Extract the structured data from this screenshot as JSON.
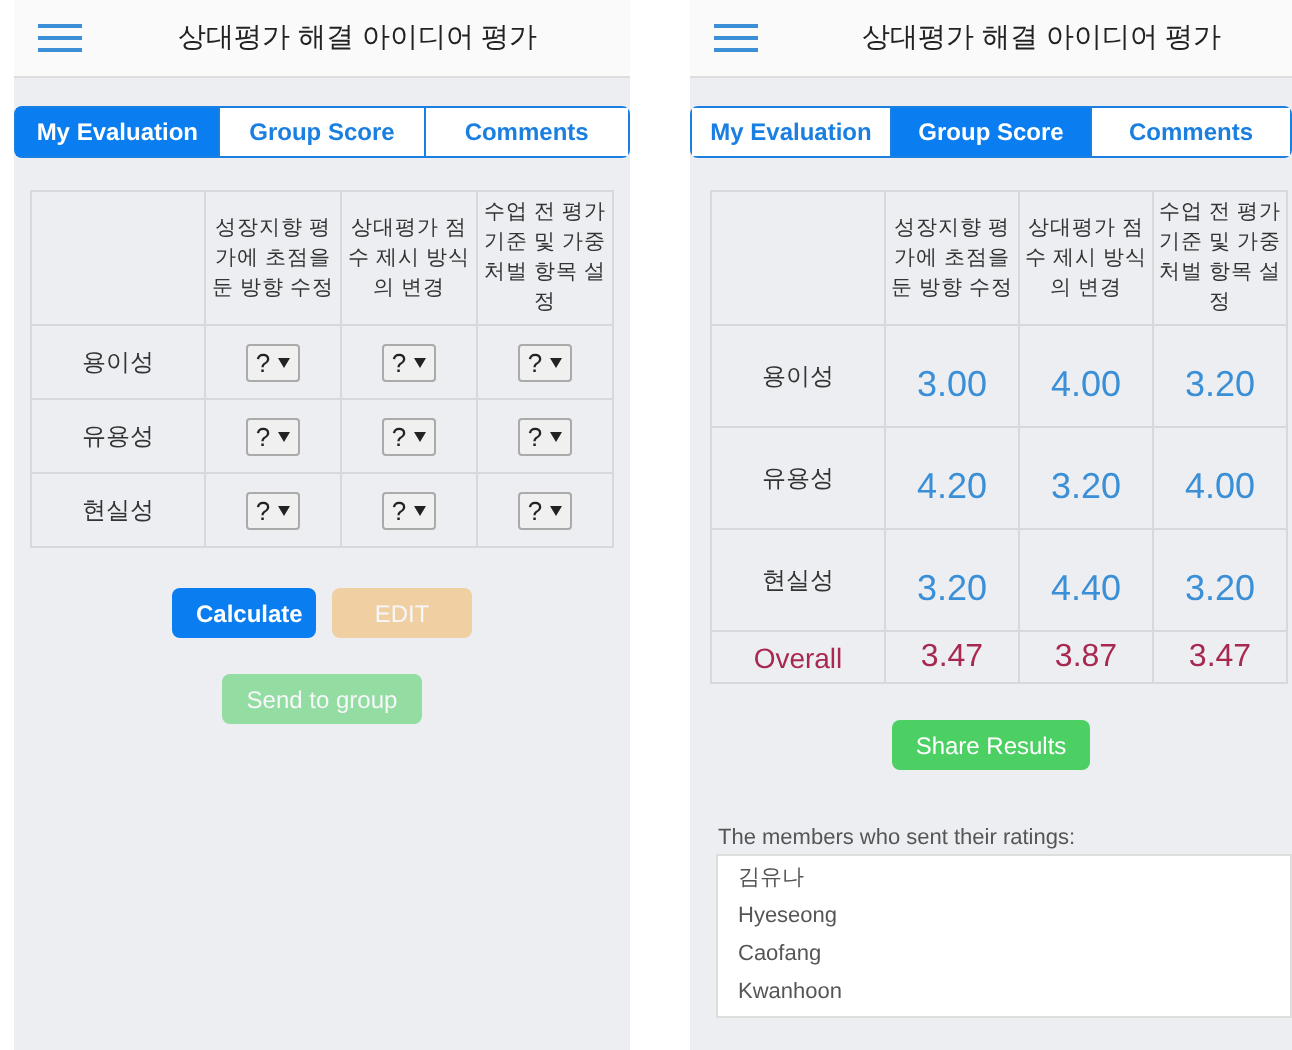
{
  "screens": [
    {
      "title": "상대평가 해결 아이디어 평가",
      "tabs": [
        {
          "label": "My Evaluation",
          "selected": true
        },
        {
          "label": "Group Score",
          "selected": false
        },
        {
          "label": "Comments",
          "selected": false
        }
      ],
      "table": {
        "columns": [
          "성장지향 평가에 초점을 둔 방향 수정",
          "상대평가 점수 제시 방식의 변경",
          "수업 전 평가 기준 및 가중 처벌 항목 설정"
        ],
        "rows": [
          {
            "kind": "select",
            "label": "용이성",
            "cells": [
              "?",
              "?",
              "?"
            ]
          },
          {
            "kind": "select",
            "label": "유용성",
            "cells": [
              "?",
              "?",
              "?"
            ]
          },
          {
            "kind": "select",
            "label": "현실성",
            "cells": [
              "?",
              "?",
              "?"
            ]
          }
        ]
      },
      "button_rows": [
        [
          {
            "label": "Calculate",
            "kind": "primary",
            "disabled": false
          },
          {
            "label": "EDIT",
            "kind": "warning",
            "disabled": true
          }
        ],
        [
          {
            "label": "Send to group",
            "kind": "success",
            "disabled": true
          }
        ]
      ]
    },
    {
      "title": "상대평가 해결 아이디어 평가",
      "tabs": [
        {
          "label": "My Evaluation",
          "selected": false
        },
        {
          "label": "Group Score",
          "selected": true
        },
        {
          "label": "Comments",
          "selected": false
        }
      ],
      "table": {
        "columns": [
          "성장지향 평가에 초점을 둔 방향 수정",
          "상대평가 점수 제시 방식의 변경",
          "수업 전 평가 기준 및 가중 처벌 항목 설정"
        ],
        "rows": [
          {
            "kind": "score",
            "label": "용이성",
            "cells": [
              "3.00",
              "4.00",
              "3.20"
            ]
          },
          {
            "kind": "score",
            "label": "유용성",
            "cells": [
              "4.20",
              "3.20",
              "4.00"
            ]
          },
          {
            "kind": "score",
            "label": "현실성",
            "cells": [
              "3.20",
              "4.40",
              "3.20"
            ]
          },
          {
            "kind": "overall",
            "label": "Overall",
            "cells": [
              "3.47",
              "3.87",
              "3.47"
            ]
          }
        ]
      },
      "button_rows": [
        [
          {
            "label": "Share Results",
            "kind": "success",
            "disabled": false
          }
        ]
      ],
      "members": {
        "label": "The members who sent their ratings:",
        "names": [
          "김유나",
          "Hyeseong",
          "Caofang",
          "Kwanhoon"
        ]
      }
    }
  ]
}
